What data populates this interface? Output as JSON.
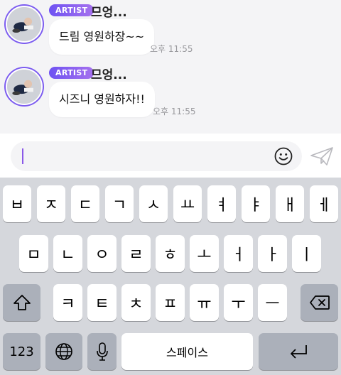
{
  "messages": [
    {
      "badge": "ARTIST",
      "name": "므엉...",
      "text": "드림 영원하장~~",
      "time": "오후 11:55"
    },
    {
      "badge": "ARTIST",
      "name": "므엉...",
      "text": "시즈니 영원하자!!",
      "time": "오후 11:55"
    }
  ],
  "input": {
    "value": ""
  },
  "keyboard": {
    "row1": [
      "ㅂ",
      "ㅈ",
      "ㄷ",
      "ㄱ",
      "ㅅ",
      "ㅛ",
      "ㅕ",
      "ㅑ",
      "ㅐ",
      "ㅔ"
    ],
    "row2": [
      "ㅁ",
      "ㄴ",
      "ㅇ",
      "ㄹ",
      "ㅎ",
      "ㅗ",
      "ㅓ",
      "ㅏ",
      "ㅣ"
    ],
    "row3": [
      "ㅋ",
      "ㅌ",
      "ㅊ",
      "ㅍ",
      "ㅠ",
      "ㅜ",
      "ㅡ"
    ],
    "numbers_label": "123",
    "space_label": "스페이스"
  },
  "icons": {
    "emoji": "smiley-icon",
    "send": "paper-plane-icon",
    "shift": "shift-arrow-icon",
    "delete": "backspace-icon",
    "globe": "globe-icon",
    "mic": "microphone-icon",
    "return": "return-icon"
  }
}
